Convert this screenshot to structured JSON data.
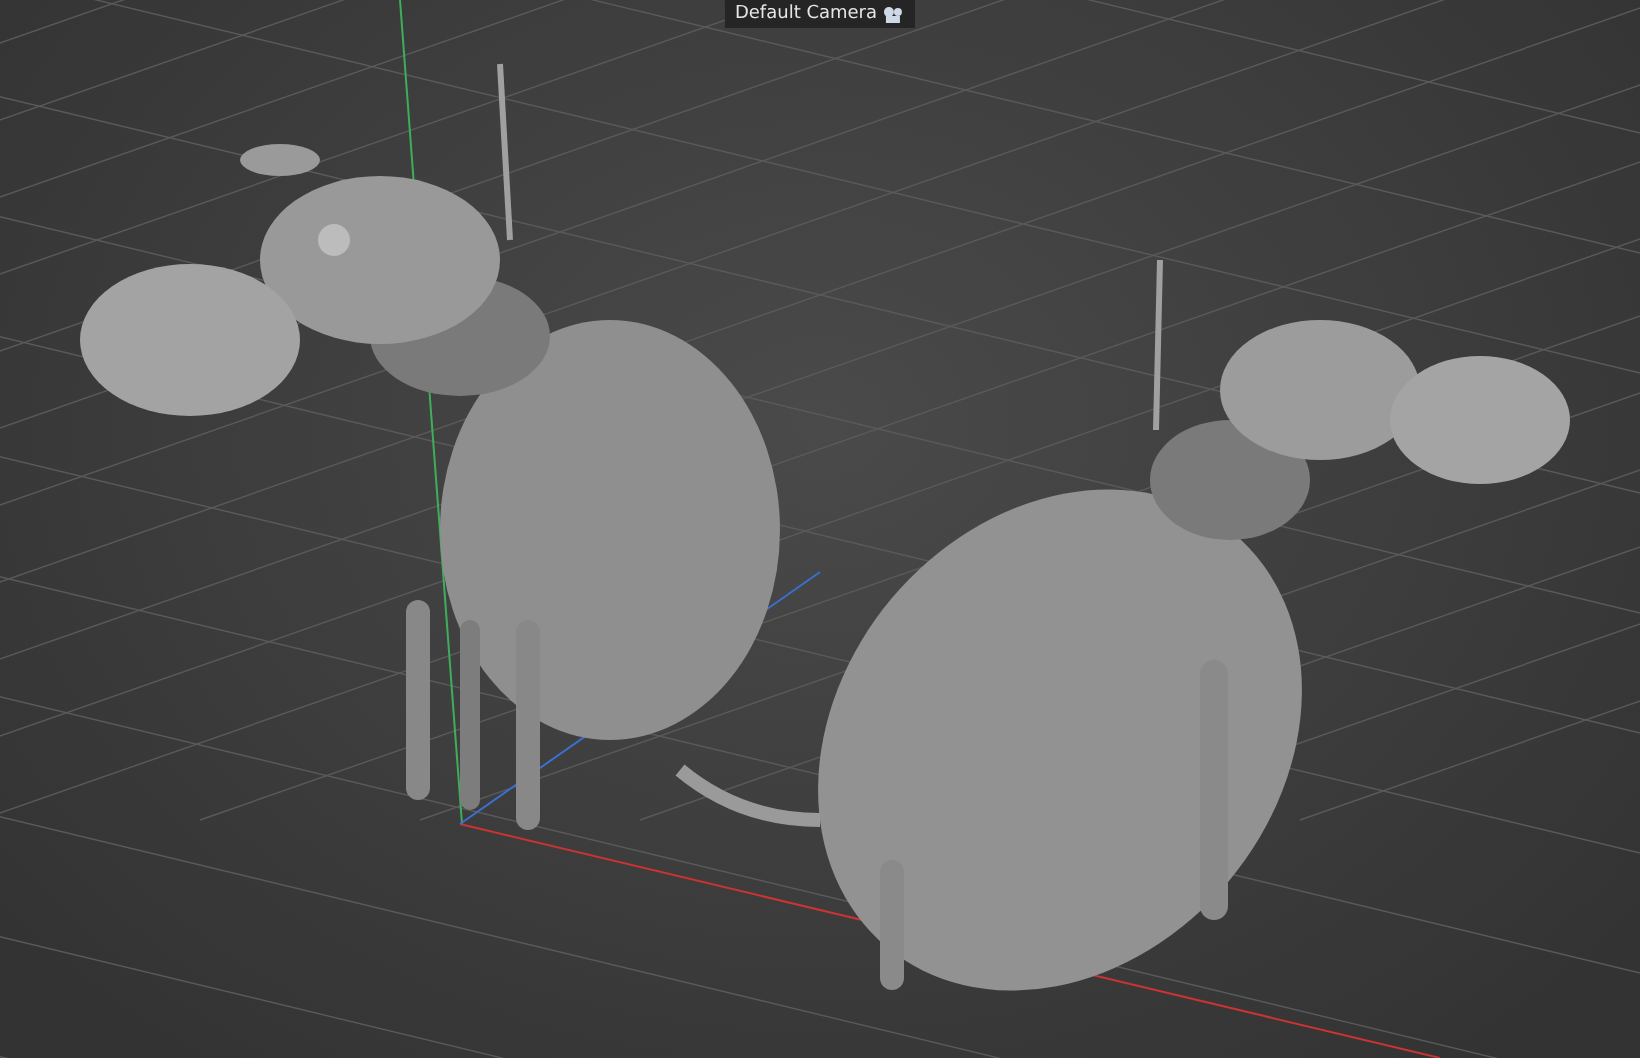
{
  "viewport": {
    "camera_label": "Default Camera"
  }
}
